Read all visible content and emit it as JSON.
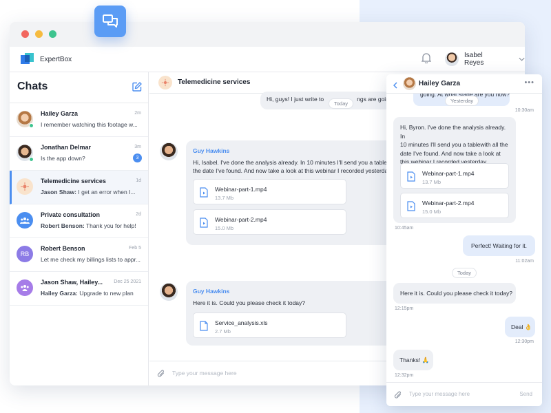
{
  "app": {
    "brand_name": "ExpertBox"
  },
  "user": {
    "name": "Isabel Reyes"
  },
  "colors": {
    "accent": "#4b8ef0",
    "online": "#3ec48f",
    "bubble": "#eef0f4",
    "bubble_out": "#e3ecfb"
  },
  "sidebar": {
    "title": "Chats",
    "chats": [
      {
        "name": "Hailey Garza",
        "time": "2m",
        "message": "I remember watching this footage w..."
      },
      {
        "name": "Jonathan Delmar",
        "time": "3m",
        "message": "Is the app down?",
        "unread": "3"
      },
      {
        "name": "Telemedicine services",
        "time": "1d",
        "message_sender": "Jason Shaw:",
        "message": "I get an error when I..."
      },
      {
        "name": "Private consultation",
        "time": "2d",
        "message_sender": "Robert Benson:",
        "message": "Thank you for help!"
      },
      {
        "name": "Robert Benson",
        "time": "Feb 5",
        "message": "Let me check my billings lists to appr...",
        "initials": "RB"
      },
      {
        "name": "Jason Shaw, Hailey...",
        "time": "Dec 25 2021",
        "message_sender": "Hailey Garza:",
        "message": "Upgrade to new plan"
      }
    ]
  },
  "main": {
    "title": "Telemedicine services",
    "top_message": "Hi, guys! I just write to",
    "top_message_tail": "ngs are going.",
    "today_chip": "Today",
    "messages": [
      {
        "sender": "Guy Hawkins",
        "text": "Hi, Isabel. I've done the analysis already. In 10 minutes I'll send you a table",
        "text2": "the date I've found. And now take a look at this webinar I recorded yesterda",
        "files": [
          {
            "name": "Webinar-part-1.mp4",
            "size": "13.7 Mb"
          },
          {
            "name": "Webinar-part-2.mp4",
            "size": "15.0 Mb"
          }
        ]
      },
      {
        "sender": "Guy Hawkins",
        "text": "Here it is. Could you please check it today?",
        "files": [
          {
            "name": "Service_analysis.xls",
            "size": "2.7 Mb"
          }
        ]
      }
    ],
    "composer_placeholder": "Type your message here"
  },
  "panel": {
    "name": "Hailey Garza",
    "top_text": "going. At what stage are you now?",
    "yesterday_chip": "Yesterday",
    "top_time": "10:30am",
    "msg1": {
      "lines": [
        "Hi, Byron. I've done the analysis already. In",
        "10 minutes I'll send you a tablewith all the",
        "date I've found. And now take a look at",
        "this webinar I recorded yesterday."
      ],
      "files": [
        {
          "name": "Webinar-part-1.mp4",
          "size": "13.7 Mb"
        },
        {
          "name": "Webinar-part-2.mp4",
          "size": "15.0 Mb"
        }
      ],
      "time": "10:45am"
    },
    "msg2": {
      "text": "Perfect! Waiting for it.",
      "time": "11:02am"
    },
    "today_chip": "Today",
    "msg3": {
      "text": "Here it is. Could you please check it today?",
      "time": "12:15pm"
    },
    "msg4": {
      "text": "Deal 👌",
      "time": "12:30pm"
    },
    "msg5": {
      "text": "Thanks! 🙏",
      "time": "12:32pm"
    },
    "composer_placeholder": "Type your message here",
    "send_label": "Send"
  }
}
